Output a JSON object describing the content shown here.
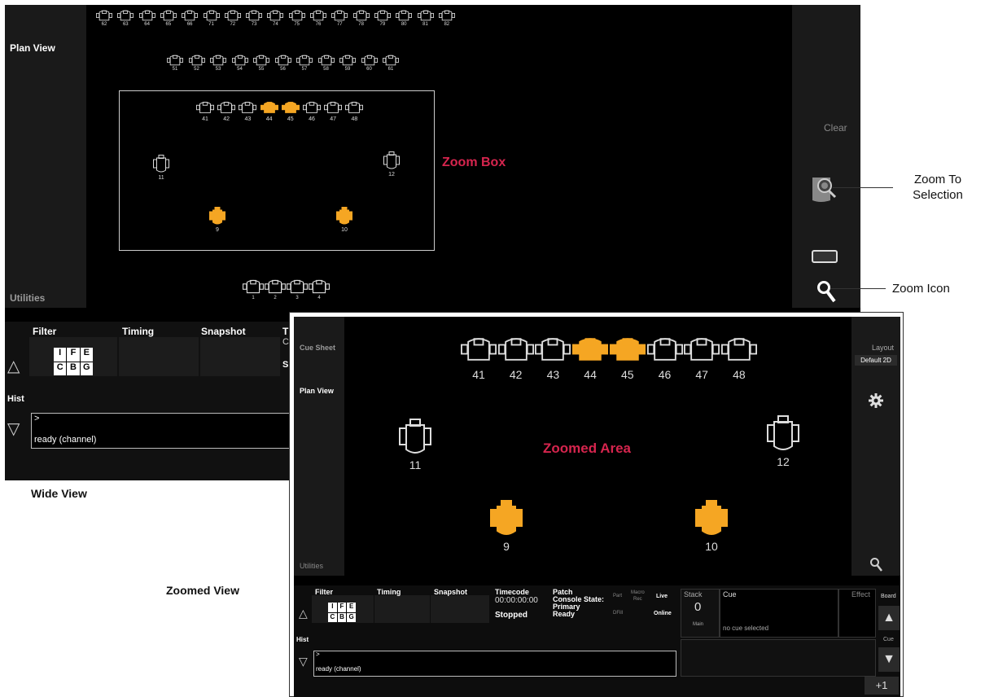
{
  "wide_view": {
    "caption": "Wide View",
    "plan_view_label": "Plan View",
    "utilities_label": "Utilities",
    "clear_label": "Clear",
    "zoom_box_label": "Zoom Box",
    "top_row_1": [
      "62",
      "63",
      "64",
      "65",
      "66",
      "71",
      "72",
      "73",
      "74",
      "75",
      "76",
      "77",
      "78",
      "79",
      "80",
      "81",
      "82"
    ],
    "top_row_2": [
      "51",
      "52",
      "53",
      "54",
      "55",
      "56",
      "57",
      "58",
      "59",
      "60",
      "61"
    ],
    "row_41": [
      "41",
      "42",
      "43",
      "44",
      "45",
      "46",
      "47",
      "48"
    ],
    "selected": [
      "44",
      "45",
      "9",
      "10"
    ],
    "singles": [
      "11",
      "12",
      "9",
      "10"
    ],
    "bottom_row": [
      "1",
      "2",
      "3",
      "4"
    ],
    "bottom_panel": {
      "filter": "Filter",
      "timing": "Timing",
      "snapshot": "Snapshot",
      "hist": "Hist",
      "prompt": ">",
      "status": "ready (channel)",
      "ifecbg": [
        "I",
        "F",
        "E",
        "C",
        "B",
        "G"
      ],
      "cut_col": "T",
      "cut_c": "C",
      "cut_s": "S"
    }
  },
  "callouts": {
    "zoom_to_selection": "Zoom To\nSelection",
    "zoom_icon": "Zoom Icon"
  },
  "zoomed_view": {
    "caption": "Zoomed View",
    "cue_sheet": "Cue Sheet",
    "plan_view": "Plan View",
    "utilities": "Utilities",
    "zoomed_area": "Zoomed Area",
    "layout_label": "Layout",
    "layout_value": "Default 2D",
    "row_41": [
      "41",
      "42",
      "43",
      "44",
      "45",
      "46",
      "47",
      "48"
    ],
    "singles": [
      "11",
      "12",
      "9",
      "10"
    ],
    "bottom_panel": {
      "filter": "Filter",
      "timing": "Timing",
      "snapshot": "Snapshot",
      "timecode_label": "Timecode",
      "timecode_value": "00:00:00:00",
      "timecode_state": "Stopped",
      "patch": "Patch",
      "console_state": "Console State:",
      "primary": "Primary",
      "ready": "Ready",
      "part": "Part",
      "macro_rec": "Macro\nRec",
      "live": "Live",
      "dfill": "DFill",
      "online": "Online",
      "stack_label": "Stack",
      "stack_value": "0",
      "stack_main": "Main",
      "cue_label": "Cue",
      "no_cue": "no cue selected",
      "effect_label": "Effect",
      "board_label": "Board",
      "cue_small": "Cue",
      "plus_one": "+1",
      "hist": "Hist",
      "prompt": ">",
      "status": "ready (channel)",
      "ifecbg": [
        "I",
        "F",
        "E",
        "C",
        "B",
        "G"
      ]
    }
  },
  "colors": {
    "selected": "#f5a623",
    "callout_red": "#d6254e",
    "panel": "#000000"
  }
}
